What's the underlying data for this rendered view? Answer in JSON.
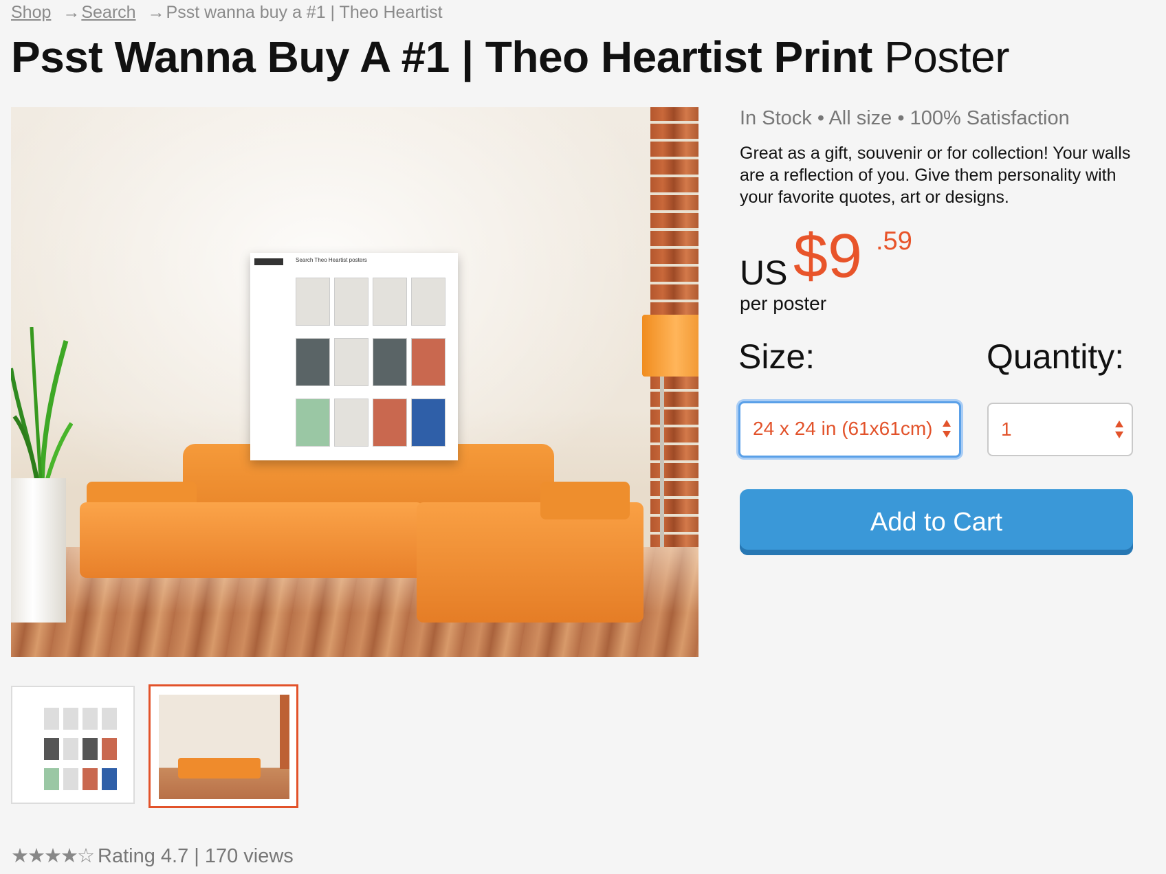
{
  "breadcrumb": {
    "shop": "Shop",
    "search": "Search",
    "current": "Psst wanna buy a #1 | Theo Heartist",
    "separator": "→"
  },
  "title": {
    "bold": "Psst Wanna Buy A #1 | Theo Heartist Print",
    "light": "Poster"
  },
  "main_image": {
    "poster_heading": "Search Theo Heartist posters"
  },
  "info": {
    "stock_line": "In Stock • All size • 100% Satisfaction",
    "description": "Great as a gift, souvenir or for collection! Your walls are a reflection of you. Give them personality with your favorite quotes, art or designs.",
    "price": {
      "currency": "US",
      "dollars": "$9",
      "cents": ".59",
      "per": "per poster"
    },
    "size_label": "Size:",
    "quantity_label": "Quantity:",
    "size_value": "24 x 24 in (61x61cm)",
    "quantity_value": "1",
    "add_to_cart": "Add to Cart"
  },
  "rating": {
    "stars": "★★★★☆",
    "text": "Rating 4.7 | 170 views"
  },
  "colors": {
    "accent": "#e8542a",
    "button": "#3a98d8",
    "focus": "#5aa0e8"
  }
}
